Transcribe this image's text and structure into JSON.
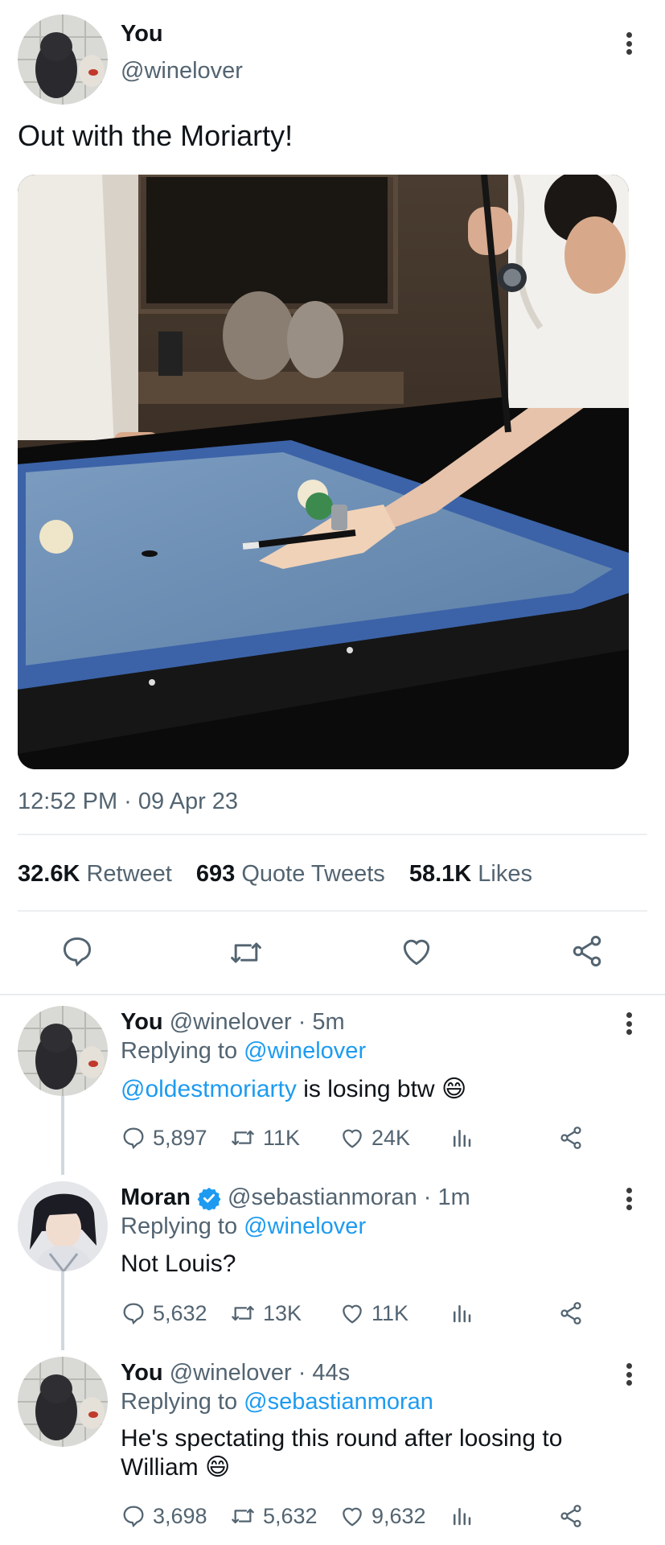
{
  "main_tweet": {
    "name": "You",
    "handle": "@winelover",
    "text": "Out with the Moriarty!",
    "timestamp": "12:52 PM · 09 Apr 23",
    "stats": {
      "retweets_count": "32.6K",
      "retweets_label": "Retweet",
      "quotes_count": "693",
      "quotes_label": "Quote Tweets",
      "likes_count": "58.1K",
      "likes_label": "Likes"
    }
  },
  "replies": [
    {
      "name": "You",
      "handle": "@winelover",
      "time": "· 5m",
      "replying_prefix": "Replying to",
      "replying_to": "@winelover",
      "mention": "@oldestmoriarty",
      "text": " is losing btw",
      "emoji": "😄",
      "replies_count": "5,897",
      "retweets_count": "11K",
      "likes_count": "24K"
    },
    {
      "name": "Moran",
      "handle": "@sebastianmoran",
      "time": "· 1m",
      "replying_prefix": "Replying to",
      "replying_to": "@winelover",
      "text": "Not Louis?",
      "replies_count": "5,632",
      "retweets_count": "13K",
      "likes_count": "11K"
    },
    {
      "name": "You",
      "handle": "@winelover",
      "time": "· 44s",
      "replying_prefix": "Replying to",
      "replying_to": "@sebastianmoran",
      "text_line1": "He's spectating this round after loosing to",
      "text_line2": "William",
      "emoji": "😄",
      "replies_count": "3,698",
      "retweets_count": "5,632",
      "likes_count": "9,632"
    }
  ],
  "icons": {
    "reply": "reply-icon",
    "retweet": "retweet-icon",
    "like": "heart-icon",
    "share": "share-icon",
    "views": "views-icon",
    "more": "more-icon",
    "verified": "verified-badge-icon"
  },
  "colors": {
    "accent": "#1d9bf0",
    "muted": "#536471",
    "table_cloth": "#6b8db3"
  }
}
